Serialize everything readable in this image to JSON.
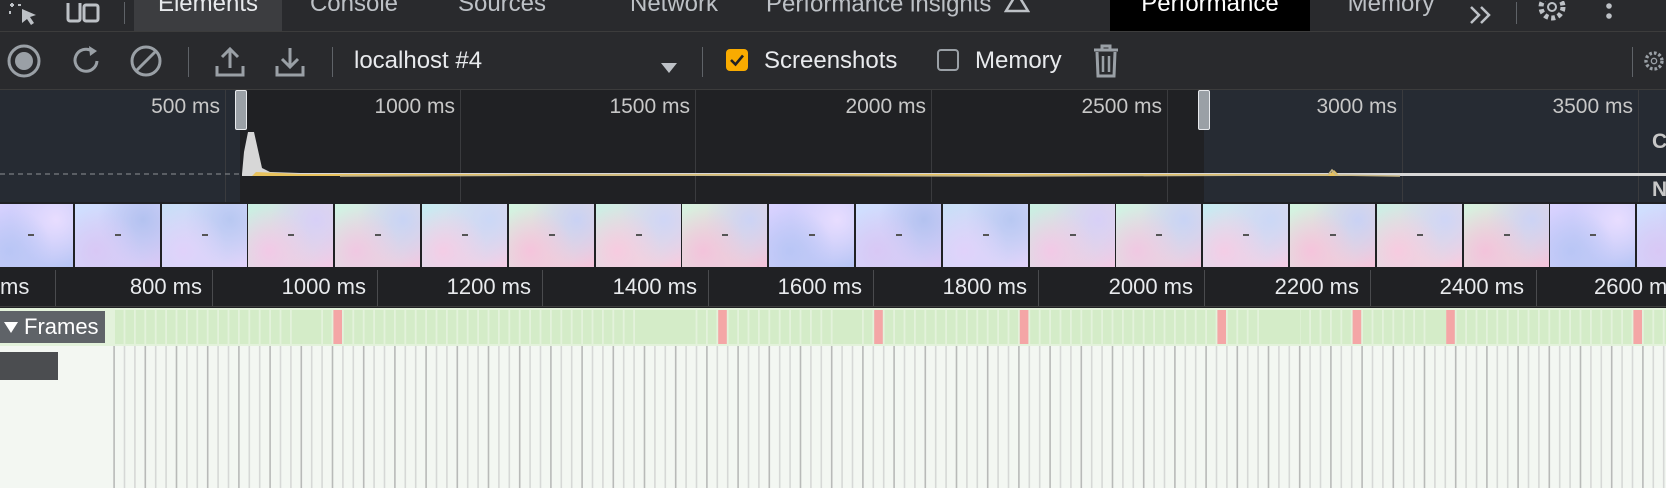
{
  "tabbar": {
    "tabs": [
      {
        "label": "Elements",
        "active": false
      },
      {
        "label": "Console",
        "active": false
      },
      {
        "label": "Sources",
        "active": false
      },
      {
        "label": "Network",
        "active": false
      },
      {
        "label": "Performance insights",
        "active": false
      },
      {
        "label": "Performance",
        "active": true
      },
      {
        "label": "Memory",
        "active": false
      }
    ],
    "icons": [
      "inspect-element-icon",
      "device-toolbar-icon",
      "more-tabs-icon",
      "settings-icon",
      "kebab-menu-icon"
    ]
  },
  "toolbar": {
    "target": "localhost #4",
    "screenshots_label": "Screenshots",
    "screenshots_checked": true,
    "memory_label": "Memory",
    "memory_checked": false,
    "icons": [
      "record-icon",
      "reload-profile-icon",
      "clear-icon",
      "upload-icon",
      "download-icon",
      "trash-icon",
      "capture-settings-icon"
    ]
  },
  "overview": {
    "labels": [
      "500 ms",
      "1000 ms",
      "1500 ms",
      "2000 ms",
      "2500 ms",
      "3000 ms",
      "3500 ms"
    ],
    "side_labels": [
      "C",
      "N"
    ]
  },
  "ruler": {
    "labels": [
      "ms",
      "800 ms",
      "1000 ms",
      "1200 ms",
      "1400 ms",
      "1600 ms",
      "1800 ms",
      "2000 ms",
      "2200 ms",
      "2400 ms",
      "2600 m"
    ]
  },
  "frames": {
    "label": "Frames"
  },
  "colors": {
    "accent_checkbox": "#f9ab00",
    "frame_ok": "#d4ecc8",
    "frame_dropped": "#f4a6a6",
    "active_tab": "#000000"
  }
}
